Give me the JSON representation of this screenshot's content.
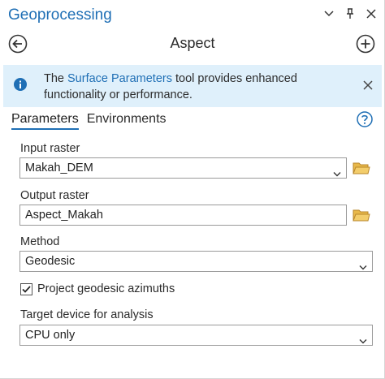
{
  "window": {
    "title": "Geoprocessing",
    "controls": [
      "chevron-down-icon",
      "pin-icon",
      "close-icon"
    ]
  },
  "tool": {
    "title": "Aspect",
    "back_icon": "back-arrow-icon",
    "add_icon": "add-icon"
  },
  "info": {
    "text_before": "The ",
    "link_text": "Surface Parameters",
    "text_after": " tool provides enhanced functionality or performance.",
    "icon": "info-icon",
    "close_icon": "close-icon"
  },
  "tabs": [
    {
      "label": "Parameters",
      "active": true
    },
    {
      "label": "Environments",
      "active": false
    }
  ],
  "help_icon": "help-icon",
  "params": {
    "input_raster": {
      "label": "Input raster",
      "value": "Makah_DEM"
    },
    "output_raster": {
      "label": "Output raster",
      "value": "Aspect_Makah"
    },
    "method": {
      "label": "Method",
      "value": "Geodesic"
    },
    "project_azimuths": {
      "label": "Project geodesic azimuths",
      "checked": true
    },
    "target_device": {
      "label": "Target device for analysis",
      "value": "CPU only"
    }
  },
  "colors": {
    "accent": "#1f6fb5",
    "info_bg": "#dff0fb",
    "folder": "#e8b84a"
  }
}
